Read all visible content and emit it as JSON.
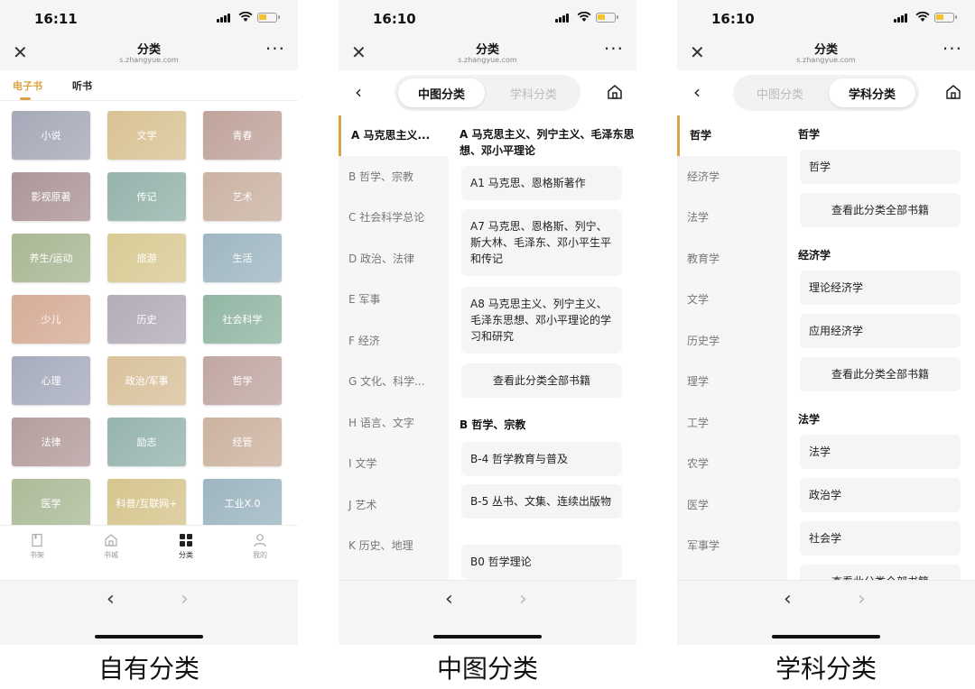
{
  "phone1": {
    "time": "16:11",
    "title": "分类",
    "domain": "s.zhangyue.com",
    "tabs": [
      "电子书",
      "听书"
    ],
    "categories": [
      {
        "label": "小说",
        "color": "#a6aab8"
      },
      {
        "label": "文学",
        "color": "#d9c394"
      },
      {
        "label": "青春",
        "color": "#c0a49c"
      },
      {
        "label": "影视原著",
        "color": "#ad9699"
      },
      {
        "label": "传记",
        "color": "#96b3ac"
      },
      {
        "label": "艺术",
        "color": "#cbb3a3"
      },
      {
        "label": "养生/运动",
        "color": "#a9b895"
      },
      {
        "label": "旅游",
        "color": "#d9cb95"
      },
      {
        "label": "生活",
        "color": "#9fb7c2"
      },
      {
        "label": "少儿",
        "color": "#d6ad98"
      },
      {
        "label": "历史",
        "color": "#b3adb9"
      },
      {
        "label": "社会科学",
        "color": "#93b7a4"
      },
      {
        "label": "心理",
        "color": "#a7acbd"
      },
      {
        "label": "政治/军事",
        "color": "#d9c29c"
      },
      {
        "label": "哲学",
        "color": "#c1a7a3"
      },
      {
        "label": "法律",
        "color": "#b59d9d"
      },
      {
        "label": "励志",
        "color": "#97b4ae"
      },
      {
        "label": "经管",
        "color": "#cdb3a0"
      },
      {
        "label": "医学",
        "color": "#acbc99"
      },
      {
        "label": "科普/互联网+",
        "color": "#d6c58e"
      },
      {
        "label": "工业X.0",
        "color": "#9db6c1"
      }
    ],
    "tabbar": [
      "书架",
      "书城",
      "分类",
      "我的"
    ],
    "caption": "自有分类"
  },
  "phone2": {
    "time": "16:10",
    "title": "分类",
    "domain": "s.zhangyue.com",
    "segments": [
      "中图分类",
      "学科分类"
    ],
    "sidebar": [
      "A 马克思主义...",
      "B 哲学、宗教",
      "C 社会科学总论",
      "D 政治、法律",
      "E 军事",
      "F 经济",
      "G 文化、科学...",
      "H 语言、文字",
      "I 文学",
      "J 艺术",
      "K 历史、地理"
    ],
    "sections": [
      {
        "heading": "A 马克思主义、列宁主义、毛泽东思想、邓小平理论",
        "cards": [
          "A1 马克思、恩格斯著作",
          "A7 马克思、恩格斯、列宁、斯大林、毛泽东、邓小平生平和传记",
          "A8 马克思主义、列宁主义、毛泽东思想、邓小平理论的学习和研究"
        ],
        "all": "查看此分类全部书籍"
      },
      {
        "heading": "B 哲学、宗教",
        "cards": [
          "B-4 哲学教育与普及",
          "B-5 丛书、文集、连续出版物",
          "B0 哲学理论"
        ]
      }
    ],
    "caption": "中图分类"
  },
  "phone3": {
    "time": "16:10",
    "title": "分类",
    "domain": "s.zhangyue.com",
    "segments": [
      "中图分类",
      "学科分类"
    ],
    "sidebar": [
      "哲学",
      "经济学",
      "法学",
      "教育学",
      "文学",
      "历史学",
      "理学",
      "工学",
      "农学",
      "医学",
      "军事学"
    ],
    "sections": [
      {
        "heading": "哲学",
        "cards": [
          "哲学"
        ],
        "all": "查看此分类全部书籍"
      },
      {
        "heading": "经济学",
        "cards": [
          "理论经济学",
          "应用经济学"
        ],
        "all": "查看此分类全部书籍"
      },
      {
        "heading": "法学",
        "cards": [
          "法学",
          "政治学",
          "社会学"
        ],
        "all": "查看此分类全部书籍"
      }
    ],
    "caption": "学科分类"
  }
}
